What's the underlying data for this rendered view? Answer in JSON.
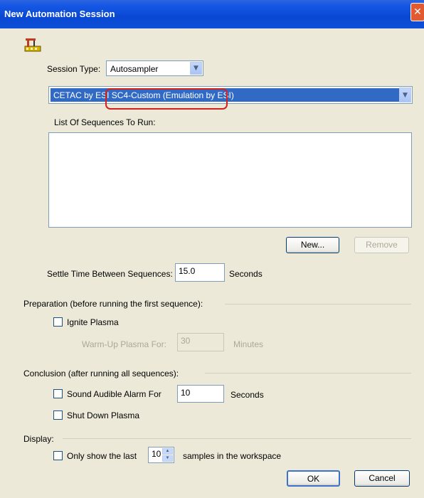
{
  "window": {
    "title": "New Automation Session",
    "close_glyph": "✕"
  },
  "session_type": {
    "label": "Session Type:",
    "value": "Autosampler"
  },
  "autosampler": {
    "value": "CETAC by ESI SC4-Custom (Emulation by ESI)",
    "highlight_color": "#d6201a"
  },
  "sequences": {
    "label": "List Of Sequences To Run:",
    "new_button": "New...",
    "remove_button": "Remove"
  },
  "settle": {
    "label": "Settle Time Between Sequences:",
    "value": "15.0",
    "unit": "Seconds"
  },
  "preparation": {
    "heading": "Preparation (before running the first sequence):",
    "ignite_label": "Ignite Plasma",
    "warmup_label": "Warm-Up Plasma For:",
    "warmup_value": "30",
    "warmup_unit": "Minutes"
  },
  "conclusion": {
    "heading": "Conclusion (after running all sequences):",
    "alarm_label": "Sound Audible Alarm For",
    "alarm_value": "10",
    "alarm_unit": "Seconds",
    "shutdown_label": "Shut Down Plasma"
  },
  "display": {
    "heading": "Display:",
    "only_show_label": "Only show the last",
    "samples_value": "10",
    "samples_suffix": "samples in the workspace"
  },
  "buttons": {
    "ok": "OK",
    "cancel": "Cancel"
  },
  "colors": {
    "title_bar": "#0a48d2",
    "selection": "#316ac5",
    "dialog_bg": "#ece9d8"
  }
}
